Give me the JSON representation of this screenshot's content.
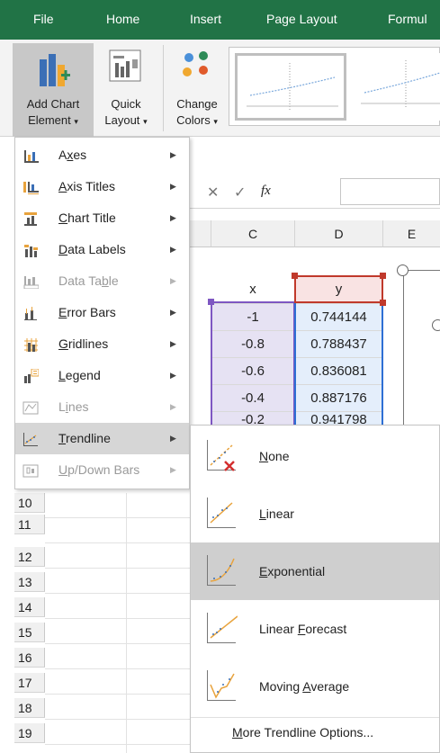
{
  "tabs": [
    "File",
    "Home",
    "Insert",
    "Page Layout",
    "Formul"
  ],
  "ribbon": {
    "add_chart_line1": "Add Chart",
    "add_chart_line2": "Element",
    "quick_line1": "Quick",
    "quick_line2": "Layout",
    "change_line1": "Change",
    "change_line2": "Colors"
  },
  "fx_label": "fx",
  "columns": [
    "C",
    "D",
    "E"
  ],
  "table": {
    "header_x": "x",
    "header_y": "y",
    "rows": [
      [
        "-1",
        "0.744144"
      ],
      [
        "-0.8",
        "0.788437"
      ],
      [
        "-0.6",
        "0.836081"
      ],
      [
        "-0.4",
        "0.887176"
      ],
      [
        "-0.2",
        "0.941798"
      ]
    ]
  },
  "row_numbers": [
    "10",
    "11",
    "12",
    "13",
    "14",
    "15",
    "16",
    "17",
    "18",
    "19"
  ],
  "menu": {
    "items": [
      {
        "pre": "A",
        "u": "x",
        "post": "es",
        "icon": "axes-icon",
        "enabled": true
      },
      {
        "pre": "",
        "u": "A",
        "post": "xis Titles",
        "icon": "axis-titles-icon",
        "enabled": true
      },
      {
        "pre": "",
        "u": "C",
        "post": "hart Title",
        "icon": "chart-title-icon",
        "enabled": true
      },
      {
        "pre": "",
        "u": "D",
        "post": "ata Labels",
        "icon": "data-labels-icon",
        "enabled": true
      },
      {
        "pre": "Data Ta",
        "u": "b",
        "post": "le",
        "icon": "data-table-icon",
        "enabled": false
      },
      {
        "pre": "",
        "u": "E",
        "post": "rror Bars",
        "icon": "error-bars-icon",
        "enabled": true
      },
      {
        "pre": "",
        "u": "G",
        "post": "ridlines",
        "icon": "gridlines-icon",
        "enabled": true
      },
      {
        "pre": "",
        "u": "L",
        "post": "egend",
        "icon": "legend-icon",
        "enabled": true
      },
      {
        "pre": "L",
        "u": "i",
        "post": "nes",
        "icon": "lines-icon",
        "enabled": false
      },
      {
        "pre": "",
        "u": "T",
        "post": "rendline",
        "icon": "trendline-icon",
        "enabled": true
      },
      {
        "pre": "",
        "u": "U",
        "post": "p/Down Bars",
        "icon": "up-down-bars-icon",
        "enabled": false
      }
    ]
  },
  "submenu": {
    "items": [
      {
        "pre": "",
        "u": "N",
        "post": "one",
        "icon": "trendline-none-icon"
      },
      {
        "pre": "",
        "u": "L",
        "post": "inear",
        "icon": "trendline-linear-icon"
      },
      {
        "pre": "",
        "u": "E",
        "post": "xponential",
        "icon": "trendline-exponential-icon"
      },
      {
        "pre": "Linear ",
        "u": "F",
        "post": "orecast",
        "icon": "trendline-forecast-icon"
      },
      {
        "pre": "Moving ",
        "u": "A",
        "post": "verage",
        "icon": "trendline-moving-average-icon"
      }
    ],
    "more_pre": "",
    "more_u": "M",
    "more_post": "ore Trendline Options..."
  },
  "colors": {
    "excel_green": "#217346",
    "highlight": "#d6d6d6",
    "x_range": "#7e57c2",
    "y_range": "#2e6fd4",
    "header_range": "#c0392b"
  }
}
